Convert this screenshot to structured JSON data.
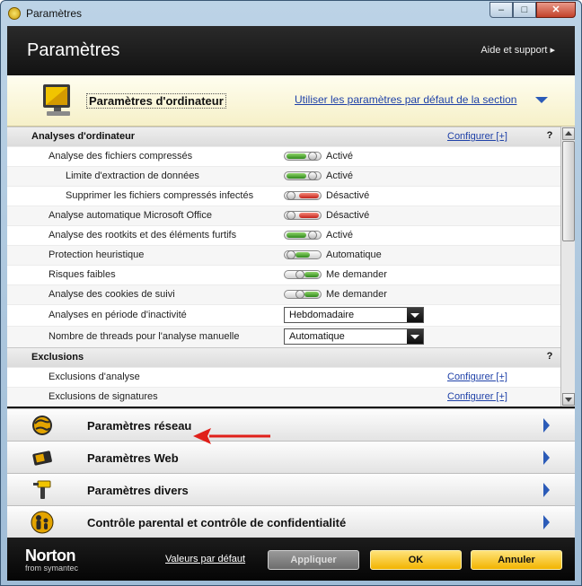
{
  "window": {
    "title": "Paramètres",
    "controls": [
      "minimize-icon",
      "maximize-icon",
      "close-icon"
    ]
  },
  "header": {
    "title": "Paramètres",
    "help_link": "Aide et support ▸"
  },
  "section": {
    "title": "Paramètres d'ordinateur",
    "defaults_link": "Utiliser les paramètres par défaut de la section"
  },
  "categories": [
    {
      "label": "Analyses d'ordinateur",
      "link": "Configurer [+]",
      "help": "?"
    },
    {
      "label": "Exclusions",
      "help": "?"
    }
  ],
  "settings": [
    {
      "label": "Analyse des fichiers compressés",
      "state": "on",
      "value": "Activé"
    },
    {
      "label": "Limite d'extraction de données",
      "state": "on",
      "value": "Activé"
    },
    {
      "label": "Supprimer les fichiers compressés infectés",
      "state": "off",
      "value": "Désactivé"
    },
    {
      "label": "Analyse automatique Microsoft Office",
      "state": "off",
      "value": "Désactivé"
    },
    {
      "label": "Analyse des rootkits et des éléments furtifs",
      "state": "on",
      "value": "Activé"
    },
    {
      "label": "Protection heuristique",
      "state": "auto",
      "value": "Automatique"
    },
    {
      "label": "Risques faibles",
      "state": "ask",
      "value": "Me demander"
    },
    {
      "label": "Analyse des cookies de suivi",
      "state": "ask",
      "value": "Me demander"
    },
    {
      "label": "Analyses en période d'inactivité",
      "select": "Hebdomadaire"
    },
    {
      "label": "Nombre de threads pour l'analyse manuelle",
      "select": "Automatique"
    }
  ],
  "exclusions": [
    {
      "label": "Exclusions d'analyse",
      "link": "Configurer [+]"
    },
    {
      "label": "Exclusions de signatures",
      "link": "Configurer [+]"
    }
  ],
  "panels": [
    {
      "label": "Paramètres réseau",
      "icon": "globe-icon"
    },
    {
      "label": "Paramètres Web",
      "icon": "web-card-icon"
    },
    {
      "label": "Paramètres divers",
      "icon": "tools-icon"
    },
    {
      "label": "Contrôle parental et contrôle de confidentialité",
      "icon": "parental-icon"
    }
  ],
  "footer": {
    "logo": "Norton",
    "logo_sub": "from symantec",
    "defaults_link": "Valeurs par défaut",
    "apply": "Appliquer",
    "ok": "OK",
    "cancel": "Annuler"
  }
}
